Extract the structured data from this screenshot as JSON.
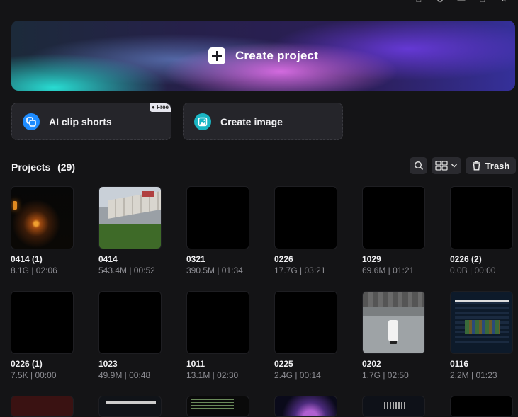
{
  "hero": {
    "label": "Create project"
  },
  "quick_actions": {
    "ai_clip": {
      "label": "AI clip shorts",
      "badge": "Free"
    },
    "create_image": {
      "label": "Create image"
    }
  },
  "projects": {
    "title": "Projects",
    "count": "(29)",
    "trash_label": "Trash"
  },
  "colors": {
    "accent_blue": "#1e8cff",
    "accent_teal": "#1ab6c4"
  },
  "tiles": [
    {
      "name": "0414 (1)",
      "meta": "8.1G | 02:06"
    },
    {
      "name": "0414",
      "meta": "543.4M | 00:52"
    },
    {
      "name": "0321",
      "meta": "390.5M | 01:34"
    },
    {
      "name": "0226",
      "meta": "17.7G | 03:21"
    },
    {
      "name": "1029",
      "meta": "69.6M | 01:21"
    },
    {
      "name": "0226 (2)",
      "meta": "0.0B | 00:00"
    },
    {
      "name": "0226 (1)",
      "meta": "7.5K | 00:00"
    },
    {
      "name": "1023",
      "meta": "49.9M | 00:48"
    },
    {
      "name": "1011",
      "meta": "13.1M | 02:30"
    },
    {
      "name": "0225",
      "meta": "2.4G | 00:14"
    },
    {
      "name": "0202",
      "meta": "1.7G | 02:50"
    },
    {
      "name": "0116",
      "meta": "2.2M | 01:23"
    }
  ]
}
